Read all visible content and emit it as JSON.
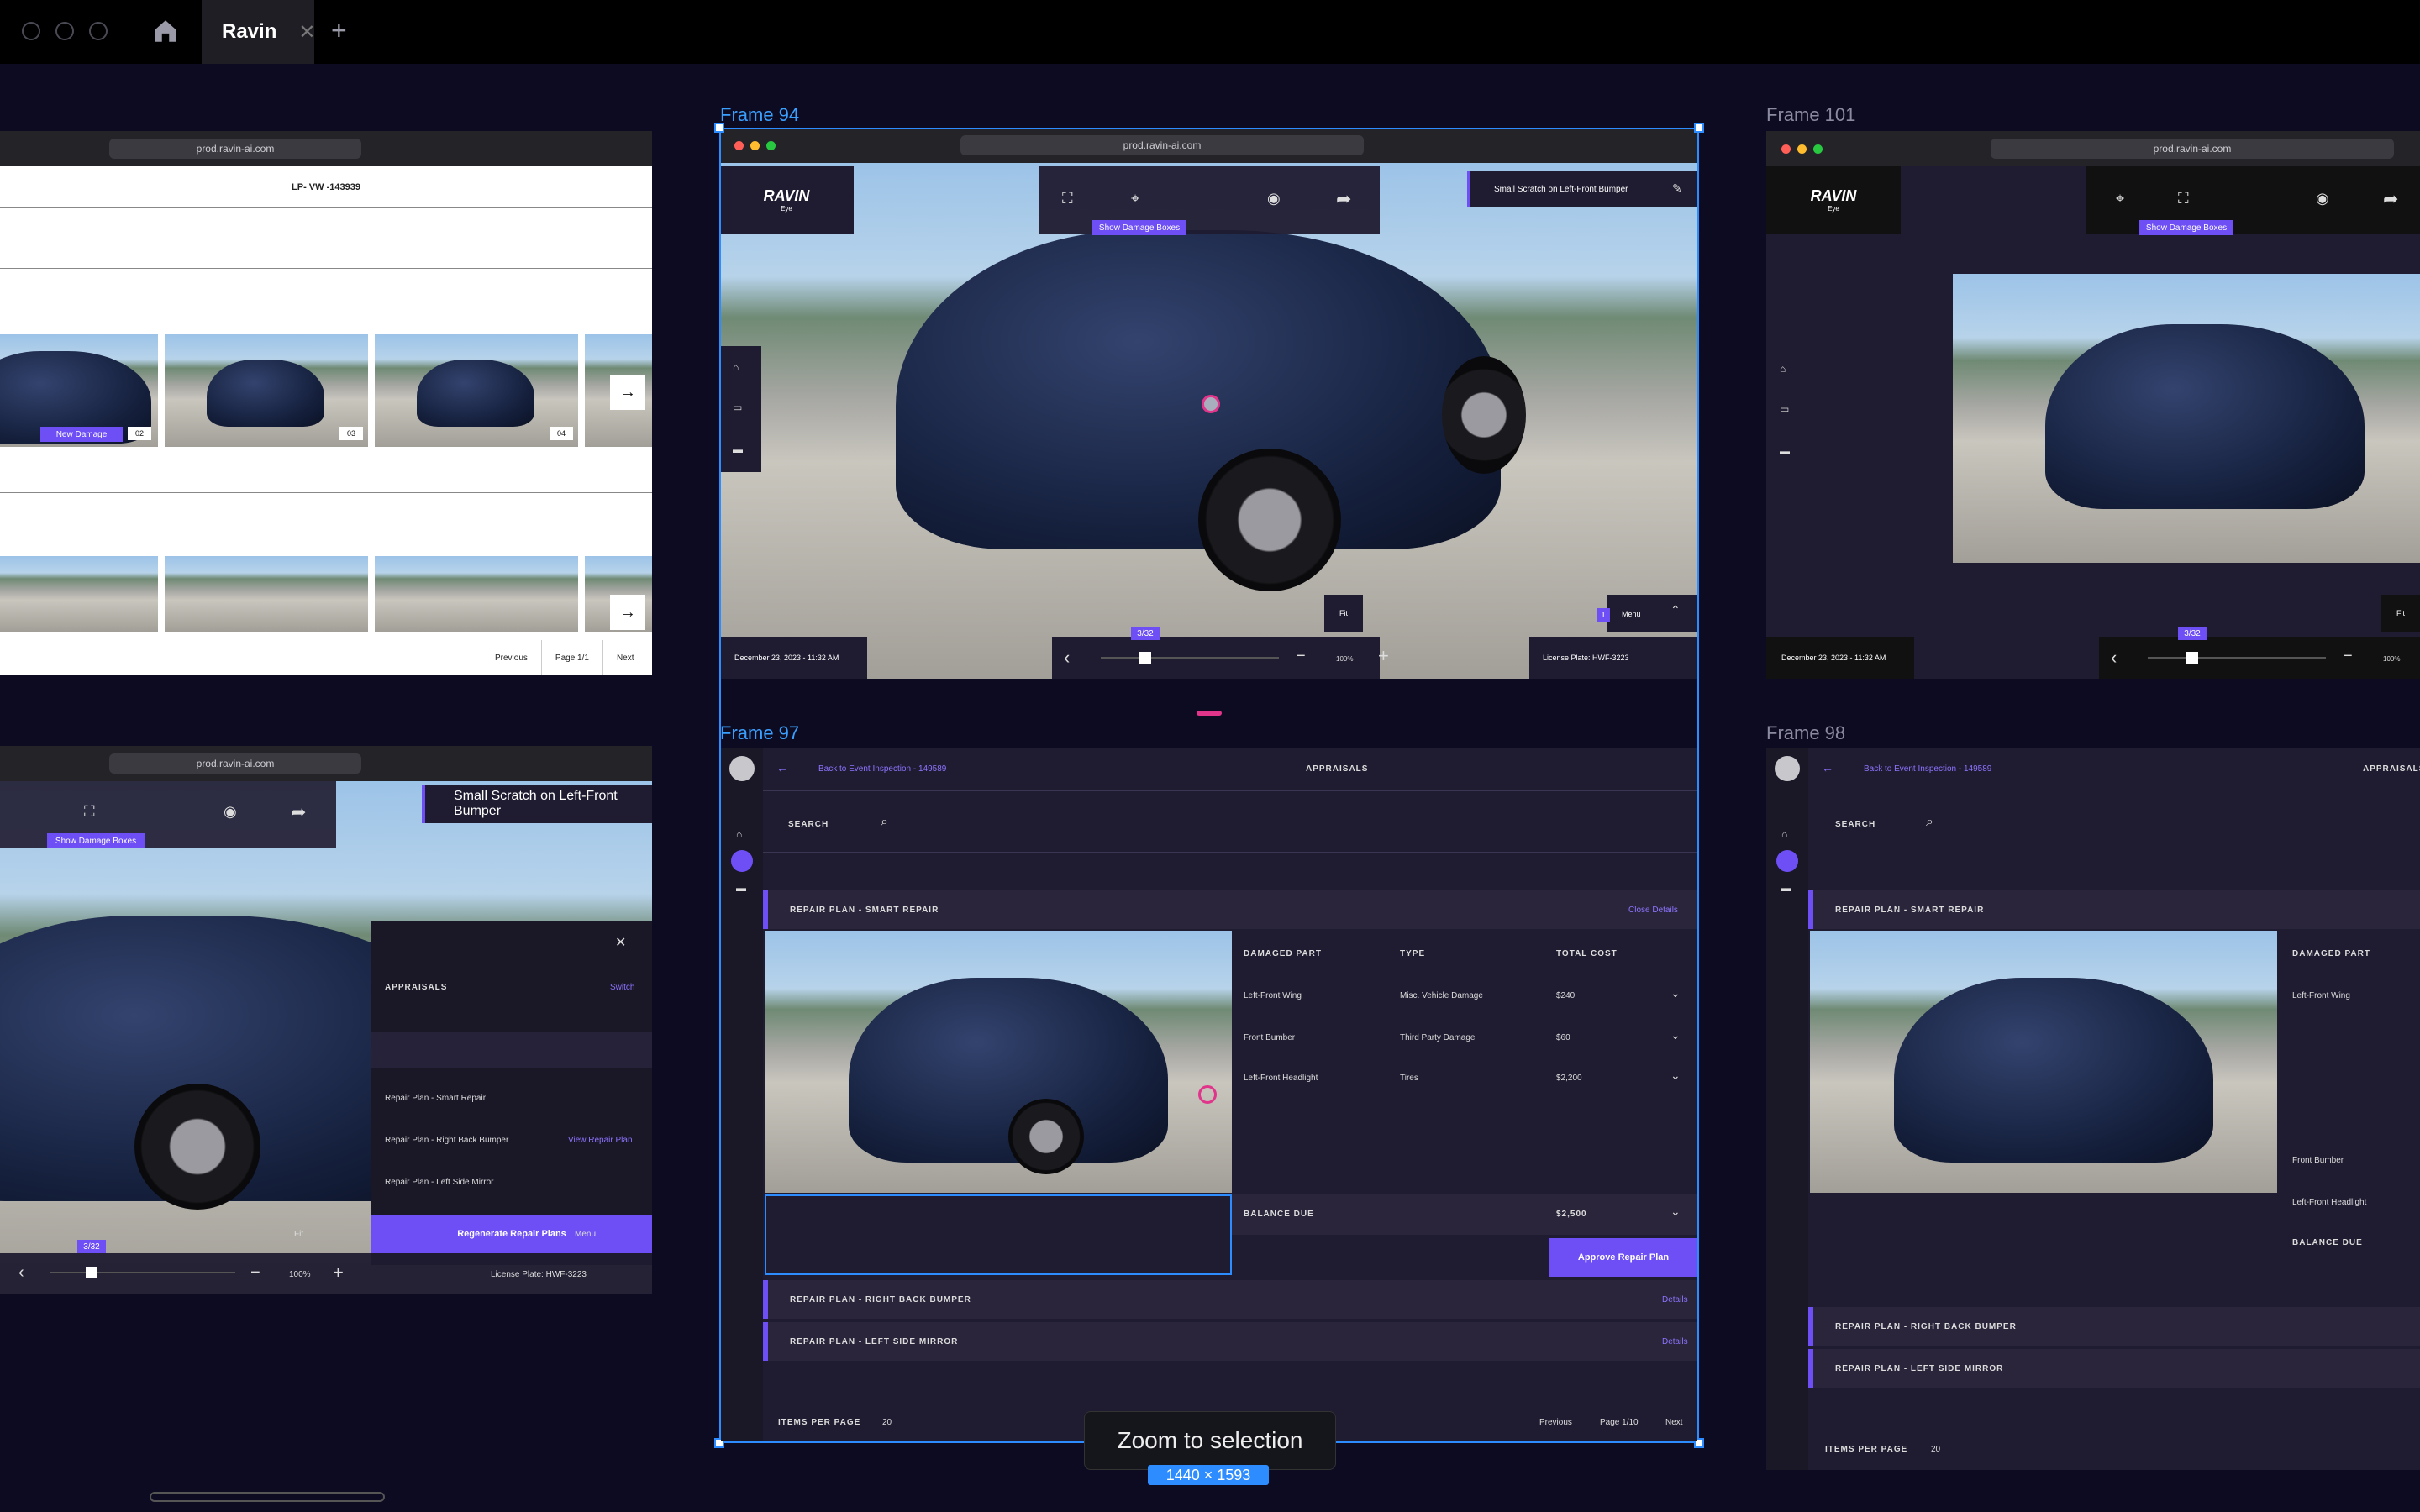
{
  "app": {
    "tab_title": "Ravin",
    "home_icon": "home-icon",
    "new_tab": "+"
  },
  "frames": {
    "f94": "Frame 94",
    "f101": "Frame 101",
    "f97": "Frame 97",
    "f98": "Frame 98"
  },
  "browser": {
    "url": "prod.ravin-ai.com"
  },
  "gallery": {
    "lp": "LP- VW -143939",
    "new_damage": "New Damage",
    "thumbs": [
      "02",
      "03",
      "04"
    ],
    "prev": "Previous",
    "page": "Page 1/1",
    "next": "Next"
  },
  "viewer": {
    "logo": "RAVIN",
    "logo_sub": "Eye",
    "show_boxes": "Show Damage Boxes",
    "damage_title": "Small Scratch on Left-Front Bumper",
    "date": "December 23, 2023 - 11:32 AM",
    "counter": "3/32",
    "zoom": "100%",
    "fit": "Fit",
    "menu": "Menu",
    "menu_count": "1",
    "license": "License Plate: HWF-3223"
  },
  "appraisal_panel": {
    "title": "APPRAISALS",
    "switch": "Switch",
    "plans": [
      "Repair Plan - Smart Repair",
      "Repair Plan - Right Back Bumper",
      "Repair Plan - Left Side Mirror"
    ],
    "view_plan": "View Repair Plan",
    "regen": "Regenerate Repair Plans"
  },
  "appraisals": {
    "back": "Back to Event Inspection - 149589",
    "title": "APPRAISALS",
    "search": "SEARCH",
    "plan1": "REPAIR PLAN - SMART REPAIR",
    "close": "Close Details",
    "headers": [
      "DAMAGED PART",
      "TYPE",
      "TOTAL COST"
    ],
    "rows": [
      {
        "part": "Left-Front Wing",
        "type": "Misc. Vehicle Damage",
        "cost": "$240"
      },
      {
        "part": "Front Bumber",
        "type": "Third Party Damage",
        "cost": "$60"
      },
      {
        "part": "Left-Front Headlight",
        "type": "Tires",
        "cost": "$2,200"
      }
    ],
    "balance": "BALANCE DUE",
    "balance_val": "$2,500",
    "approve": "Approve Repair Plan",
    "plan2": "REPAIR PLAN - RIGHT BACK BUMPER",
    "plan3": "REPAIR PLAN - LEFT SIDE MIRROR",
    "details": "Details",
    "items": "ITEMS PER PAGE",
    "items_val": "20",
    "prev": "Previous",
    "page": "Page 1/10",
    "next": "Next"
  },
  "f98": {
    "parts": [
      "Left-Front Wing",
      "Front Bumber",
      "Left-Front Headlight"
    ]
  },
  "tooltip": "Zoom to selection",
  "dims": "1440 × 1593"
}
